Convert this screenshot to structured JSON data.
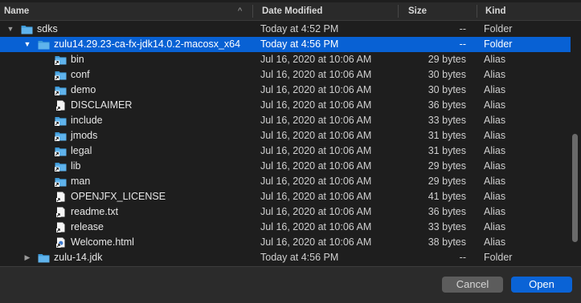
{
  "header": {
    "name": "Name",
    "date_modified": "Date Modified",
    "size": "Size",
    "kind": "Kind",
    "sort_indicator": "^"
  },
  "rows": [
    {
      "name": "sdks",
      "date": "Today at 4:52 PM",
      "size": "--",
      "kind": "Folder",
      "icon": "folder-icon",
      "disclosure": "▼"
    },
    {
      "name": "zulu14.29.23-ca-fx-jdk14.0.2-macosx_x64",
      "date": "Today at 4:56 PM",
      "size": "--",
      "kind": "Folder",
      "icon": "folder-icon",
      "disclosure": "▼"
    },
    {
      "name": "bin",
      "date": "Jul 16, 2020 at 10:06 AM",
      "size": "29 bytes",
      "kind": "Alias",
      "icon": "folder-alias-icon"
    },
    {
      "name": "conf",
      "date": "Jul 16, 2020 at 10:06 AM",
      "size": "30 bytes",
      "kind": "Alias",
      "icon": "folder-alias-icon"
    },
    {
      "name": "demo",
      "date": "Jul 16, 2020 at 10:06 AM",
      "size": "30 bytes",
      "kind": "Alias",
      "icon": "folder-alias-icon"
    },
    {
      "name": "DISCLAIMER",
      "date": "Jul 16, 2020 at 10:06 AM",
      "size": "36 bytes",
      "kind": "Alias",
      "icon": "file-alias-icon"
    },
    {
      "name": "include",
      "date": "Jul 16, 2020 at 10:06 AM",
      "size": "33 bytes",
      "kind": "Alias",
      "icon": "folder-alias-icon"
    },
    {
      "name": "jmods",
      "date": "Jul 16, 2020 at 10:06 AM",
      "size": "31 bytes",
      "kind": "Alias",
      "icon": "folder-alias-icon"
    },
    {
      "name": "legal",
      "date": "Jul 16, 2020 at 10:06 AM",
      "size": "31 bytes",
      "kind": "Alias",
      "icon": "folder-alias-icon"
    },
    {
      "name": "lib",
      "date": "Jul 16, 2020 at 10:06 AM",
      "size": "29 bytes",
      "kind": "Alias",
      "icon": "folder-alias-icon"
    },
    {
      "name": "man",
      "date": "Jul 16, 2020 at 10:06 AM",
      "size": "29 bytes",
      "kind": "Alias",
      "icon": "folder-alias-icon"
    },
    {
      "name": "OPENJFX_LICENSE",
      "date": "Jul 16, 2020 at 10:06 AM",
      "size": "41 bytes",
      "kind": "Alias",
      "icon": "file-alias-icon"
    },
    {
      "name": "readme.txt",
      "date": "Jul 16, 2020 at 10:06 AM",
      "size": "36 bytes",
      "kind": "Alias",
      "icon": "file-alias-icon"
    },
    {
      "name": "release",
      "date": "Jul 16, 2020 at 10:06 AM",
      "size": "33 bytes",
      "kind": "Alias",
      "icon": "file-alias-icon"
    },
    {
      "name": "Welcome.html",
      "date": "Jul 16, 2020 at 10:06 AM",
      "size": "38 bytes",
      "kind": "Alias",
      "icon": "html-alias-icon"
    },
    {
      "name": "zulu-14.jdk",
      "date": "Today at 4:56 PM",
      "size": "--",
      "kind": "Folder",
      "icon": "folder-icon",
      "disclosure": "▶"
    }
  ],
  "buttons": {
    "cancel": "Cancel",
    "open": "Open"
  },
  "colors": {
    "selection": "#0861d4",
    "folder": "#3d9ad9",
    "primary_button": "#0a63d6"
  }
}
